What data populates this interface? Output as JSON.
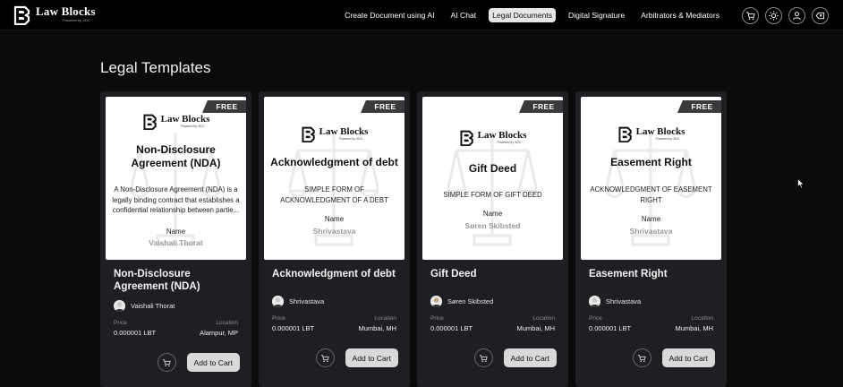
{
  "brand": {
    "name": "Law Blocks",
    "powered_by": "Powered by XDC"
  },
  "nav": [
    {
      "label": "Create Document using AI",
      "active": false
    },
    {
      "label": "AI Chat",
      "active": false
    },
    {
      "label": "Legal Documents",
      "active": true
    },
    {
      "label": "Digital Signature",
      "active": false
    },
    {
      "label": "Arbitrators & Mediators",
      "active": false
    }
  ],
  "header_icons": [
    "cart-icon",
    "sun-icon",
    "user-icon",
    "logout-icon"
  ],
  "page": {
    "title": "Legal Templates"
  },
  "labels": {
    "free": "FREE",
    "name": "Name",
    "price": "Price",
    "location": "Location",
    "add_to_cart": "Add to Cart"
  },
  "cards": [
    {
      "preview_title": "Non-Disclosure Agreement (NDA)",
      "preview_desc": "A Non-Disclosure Agreement (NDA) is a legally binding contract that establishes a confidential relationship between partie...",
      "preview_name": "Vaishali Thorat",
      "title": "Non-Disclosure Agreement (NDA)",
      "author": "Vaishali Thorat",
      "price": "0.000001 LBT",
      "location": "Alampur, MP"
    },
    {
      "preview_title": "Acknowledgment of debt",
      "preview_desc": "SIMPLE FORM OF ACKNOWLEDGMENT OF A DEBT",
      "preview_name": "Shrivastava",
      "title": "Acknowledgment of debt",
      "author": "Shrivastava",
      "price": "0.000001 LBT",
      "location": "Mumbai, MH"
    },
    {
      "preview_title": "Gift Deed",
      "preview_desc": "SIMPLE FORM OF GIFT DEED",
      "preview_name": "Søren Skibsted",
      "title": "Gift Deed",
      "author": "Søren Skibsted",
      "price": "0.000001 LBT",
      "location": "Mumbai, MH"
    },
    {
      "preview_title": "Easement Right",
      "preview_desc": "ACKNOWLEDGMENT OF EASEMENT RIGHT",
      "preview_name": "Shrivastava",
      "title": "Easement Right",
      "author": "Shrivastava",
      "price": "0.000001 LBT",
      "location": "Mumbai, MH"
    }
  ]
}
